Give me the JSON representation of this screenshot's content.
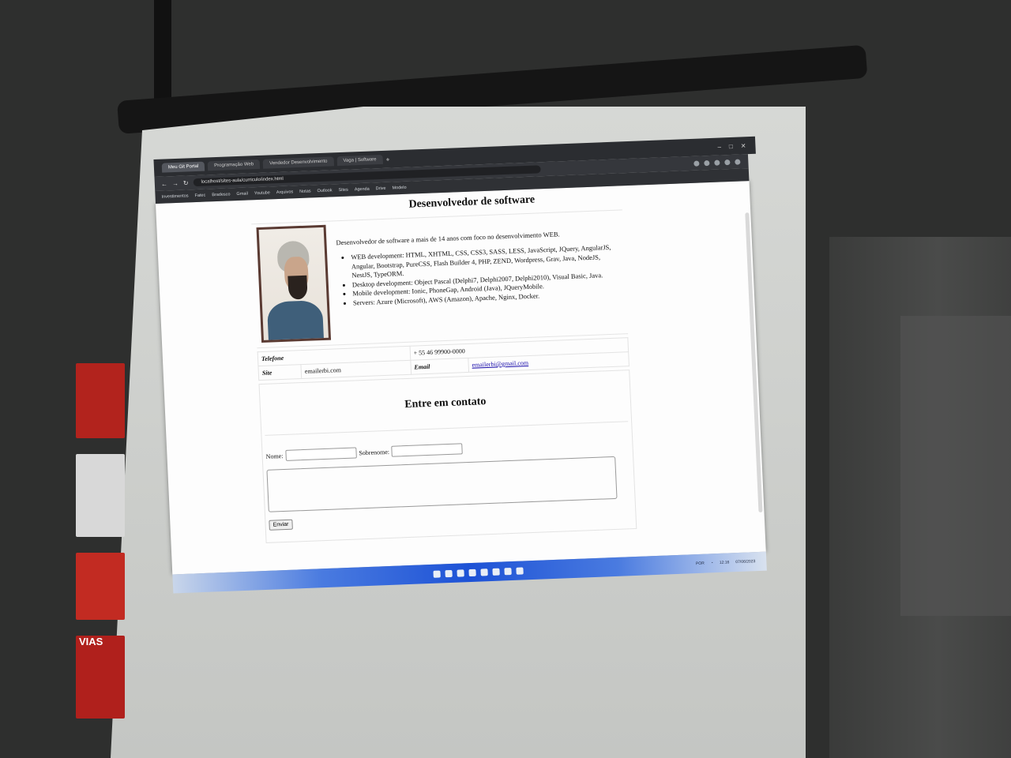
{
  "browser": {
    "tabs": [
      "Meu Git Portal",
      "Programação Web",
      "Vendedor Desenvolvimento",
      "Vaga | Software"
    ],
    "url": "localhost/sites-aula/curriculo/index.html",
    "bookmarks": [
      "Investimentos",
      "Fatec",
      "Bradesco",
      "Gmail",
      "Youtube",
      "Arquivos",
      "Notas",
      "Outlook",
      "Sites",
      "Agenda",
      "Drive",
      "Modelo"
    ]
  },
  "page": {
    "title": "Desenvolvedor de software",
    "summary": "Desenvolvedor de software a mais de 14 anos com foco no desenvolvimento WEB.",
    "skills": [
      "WEB development: HTML, XHTML, CSS, CSS3, SASS, LESS, JavaScript, JQuery, AngularJS, Angular, Bootstrap, PureCSS, Flash Builder 4, PHP, ZEND, Wordpress, Grav, Java, NodeJS, NestJS, TypeORM.",
      "Desktop development: Object Pascal (Delphi7, Delphi2007, Delphi2010), Visual Basic, Java.",
      "Mobile development: Ionic, PhoneGap, Android (Java), JQueryMobile.",
      "Servers: Azure (Microsoft), AWS (Amazon), Apache, Nginx, Docker."
    ],
    "info": {
      "phone_label": "Telefone",
      "phone_value": "+ 55 46 99900-0000",
      "site_label": "Site",
      "site_value": "emailerbi.com",
      "email_label": "Email",
      "email_value": "emailerbi@gmail.com"
    },
    "contact": {
      "title": "Entre em contato",
      "name_label": "Nome:",
      "surname_label": "Sobrenome:",
      "send_label": "Enviar"
    }
  },
  "taskbar": {
    "tray_lang": "POR",
    "time": "12:16",
    "date": "07/06/2023"
  }
}
